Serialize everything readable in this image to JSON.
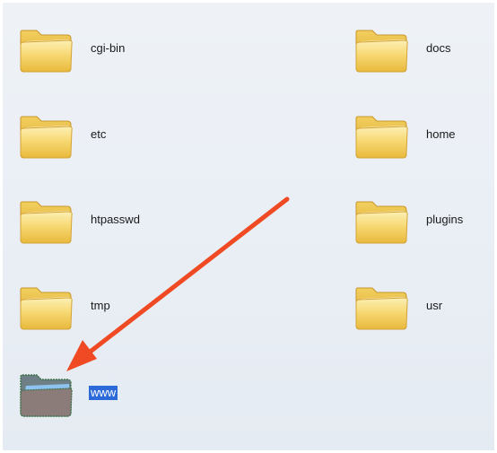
{
  "folders": [
    {
      "name": "cgi-bin",
      "selected": false
    },
    {
      "name": "docs",
      "selected": false
    },
    {
      "name": "etc",
      "selected": false
    },
    {
      "name": "home",
      "selected": false
    },
    {
      "name": "htpasswd",
      "selected": false
    },
    {
      "name": "plugins",
      "selected": false
    },
    {
      "name": "tmp",
      "selected": false
    },
    {
      "name": "usr",
      "selected": false
    },
    {
      "name": "www",
      "selected": true
    }
  ],
  "colors": {
    "folder_fill": "#f6d66e",
    "folder_shade": "#e7bc3f",
    "selection": "#2b6ad8",
    "arrow": "#ef4a23"
  }
}
